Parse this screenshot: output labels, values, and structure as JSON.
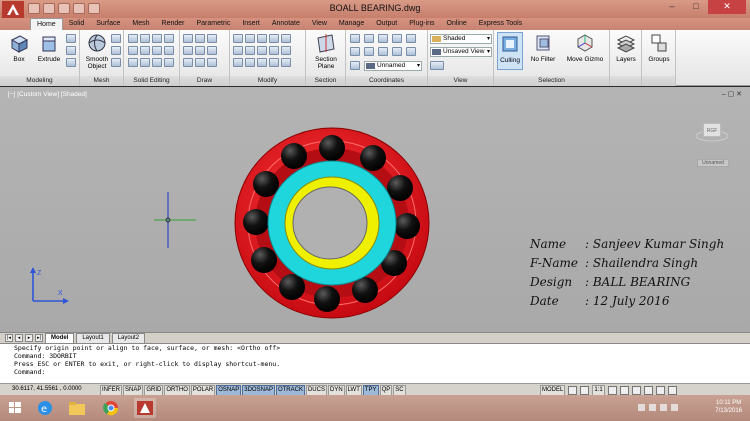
{
  "window": {
    "title": "BOALL BEARING.dwg"
  },
  "ribbon": {
    "tabs": [
      "Home",
      "Solid",
      "Surface",
      "Mesh",
      "Render",
      "Parametric",
      "Insert",
      "Annotate",
      "View",
      "Manage",
      "Output",
      "Plug-ins",
      "Online",
      "Express Tools"
    ],
    "panels": {
      "modeling": {
        "title": "Modeling",
        "box": "Box",
        "extrude": "Extrude"
      },
      "mesh": {
        "title": "Mesh",
        "smooth": "Smooth Object"
      },
      "solid_editing": {
        "title": "Solid Editing"
      },
      "draw": {
        "title": "Draw"
      },
      "modify": {
        "title": "Modify"
      },
      "section": {
        "title": "Section",
        "plane": "Section Plane"
      },
      "coordinates": {
        "title": "Coordinates",
        "ucs_combo": "Unnamed"
      },
      "view": {
        "title": "View",
        "visual_style": "Shaded",
        "saved_view": "Unsaved View"
      },
      "selection": {
        "title": "Selection",
        "culling": "Culling",
        "no_filter": "No Filter",
        "move_gizmo": "Move Gizmo"
      },
      "layers": {
        "label": "Layers"
      },
      "groups": {
        "label": "Groups"
      }
    }
  },
  "viewport": {
    "label": "[−] [Custom View] [Shaded]",
    "viewcube_face": "RGF",
    "wcs_menu": "Unnamed",
    "info": [
      {
        "label": "Name",
        "value": ": Sanjeev Kumar Singh"
      },
      {
        "label": "F-Name",
        "value": ": Shailendra Singh"
      },
      {
        "label": "Design",
        "value": ": BALL  BEARING"
      },
      {
        "label": "Date",
        "value": ": 12 July 2016"
      }
    ]
  },
  "layout_tabs": [
    "Model",
    "Layout1",
    "Layout2"
  ],
  "command": {
    "lines": [
      "Specify origin point or align to face, surface, or mesh:  <Ortho off>",
      "Command: 3DORBIT",
      "Press ESC or ENTER to exit, or right-click to display shortcut-menu.",
      "Command:"
    ]
  },
  "status": {
    "coords": "30.6117, 41.5561 , 0.0000",
    "buttons": [
      {
        "label": "INFER",
        "on": false
      },
      {
        "label": "SNAP",
        "on": false
      },
      {
        "label": "GRID",
        "on": false
      },
      {
        "label": "ORTHO",
        "on": false
      },
      {
        "label": "POLAR",
        "on": false
      },
      {
        "label": "OSNAP",
        "on": true
      },
      {
        "label": "3DOSNAP",
        "on": true
      },
      {
        "label": "OTRACK",
        "on": true
      },
      {
        "label": "DUCS",
        "on": false
      },
      {
        "label": "DYN",
        "on": false
      },
      {
        "label": "LWT",
        "on": false
      },
      {
        "label": "TPY",
        "on": true
      },
      {
        "label": "QP",
        "on": false
      },
      {
        "label": "SC",
        "on": false
      }
    ],
    "model": "MODEL",
    "scale": "1:1"
  },
  "taskbar": {
    "time": "10:11 PM",
    "date": "7/13/2016"
  },
  "colors": {
    "outer_race": "#e8141c",
    "inner_race_outer": "#1fd6dd",
    "inner_race_inner": "#eef000",
    "balls": "#111111"
  }
}
